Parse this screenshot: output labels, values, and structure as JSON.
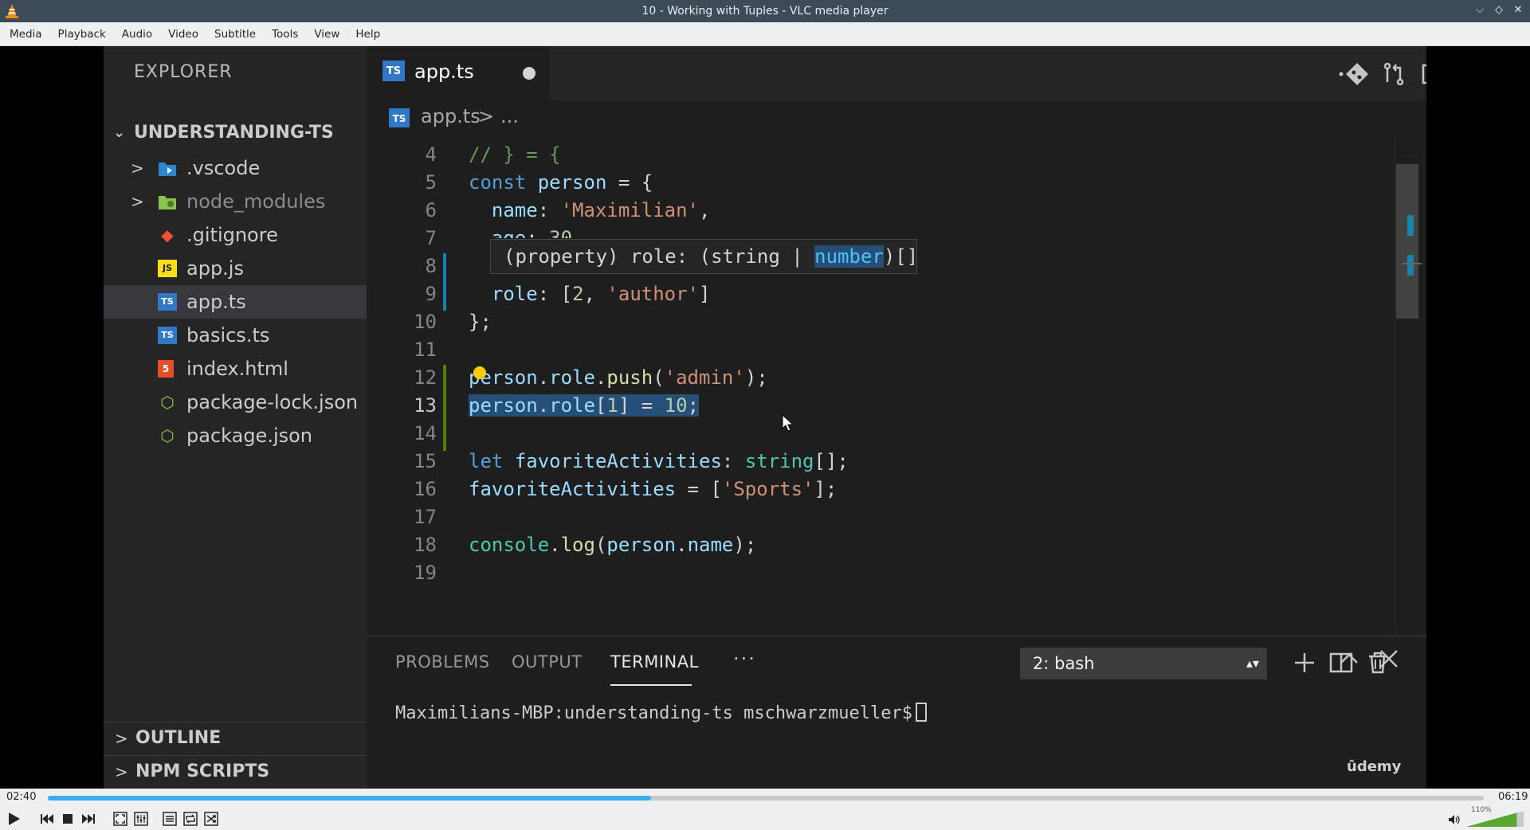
{
  "window": {
    "title": "10 - Working with Tuples - VLC media player",
    "controls": {
      "minimize": "⌵",
      "maximize": "◇",
      "close": "✕"
    }
  },
  "menu": [
    "Media",
    "Playback",
    "Audio",
    "Video",
    "Subtitle",
    "Tools",
    "View",
    "Help"
  ],
  "video": {
    "sidebar": {
      "title": "EXPLORER",
      "project": "UNDERSTANDING-TS",
      "items": [
        {
          "label": ".vscode",
          "icon": "folder-vscode-icon",
          "chevron": ">"
        },
        {
          "label": "node_modules",
          "icon": "folder-node-icon",
          "chevron": ">"
        },
        {
          "label": ".gitignore",
          "icon": "git-icon",
          "badge": "◆"
        },
        {
          "label": "app.js",
          "icon": "js-file-icon",
          "badge": "JS"
        },
        {
          "label": "app.ts",
          "icon": "ts-file-icon",
          "badge": "TS"
        },
        {
          "label": "basics.ts",
          "icon": "ts-file-icon",
          "badge": "TS"
        },
        {
          "label": "index.html",
          "icon": "html-file-icon",
          "badge": "5"
        },
        {
          "label": "package-lock.json",
          "icon": "nodejs-icon",
          "badge": "⬡"
        },
        {
          "label": "package.json",
          "icon": "nodejs-icon",
          "badge": "⬡"
        }
      ],
      "outline": "OUTLINE",
      "npm_scripts": "NPM SCRIPTS"
    },
    "editor": {
      "tab_label": "app.ts",
      "ts_badge": "TS",
      "breadcrumb": {
        "file": "app.ts",
        "separator": ">",
        "more": "..."
      },
      "line_numbers": [
        "4",
        "5",
        "6",
        "7",
        "8",
        "9",
        "10",
        "11",
        "12",
        "13",
        "14",
        "15",
        "16",
        "17",
        "18",
        "19"
      ],
      "hover_text": {
        "before": "(property) role: (string | ",
        "highlight": "number",
        "after": ")[]"
      },
      "code": {
        "l4": "// } = {",
        "l5_kw": "const",
        "l5_var": "person",
        "l5_rest": " = {",
        "l6_key": "name",
        "l6_str": "'Maximilian'",
        "l7_key": "age",
        "l7_num": "30",
        "l9_key": "role",
        "l9_num": "2",
        "l9_str": "'author'",
        "l10": "};",
        "l12_obj": "person",
        "l12_prop": "role",
        "l12_fn": "push",
        "l12_str": "'admin'",
        "l13_obj": "person",
        "l13_prop": "role",
        "l13_idx": "1",
        "l13_num": "10",
        "l15_kw": "let",
        "l15_var": "favoriteActivities",
        "l15_type": "string",
        "l16_var": "favoriteActivities",
        "l16_str": "'Sports'",
        "l18_obj": "console",
        "l18_fn": "log",
        "l18_arg_obj": "person",
        "l18_arg_prop": "name"
      }
    },
    "panel": {
      "tabs": [
        "PROBLEMS",
        "OUTPUT",
        "TERMINAL"
      ],
      "more": "···",
      "shell": "2: bash",
      "prompt": "Maximilians-MBP:understanding-ts mschwarzmueller$",
      "watermark": "ûdemy"
    }
  },
  "player": {
    "elapsed": "02:40",
    "total": "06:19",
    "progress": 0.42,
    "volume_label": "110%",
    "volume": 1.1,
    "accent": "#3daee9"
  }
}
